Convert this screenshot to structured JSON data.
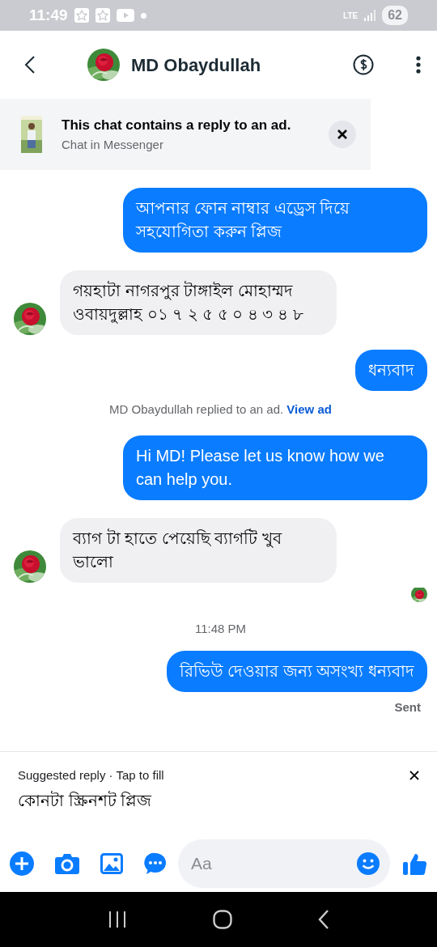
{
  "status_bar": {
    "time": "11:49",
    "network": "LTE",
    "battery": "62"
  },
  "header": {
    "contact_name": "MD Obaydullah"
  },
  "ad_banner": {
    "title": "This chat contains a reply to an ad.",
    "subtitle": "Chat in Messenger"
  },
  "messages": [
    {
      "kind": "outgoing",
      "text": "আপনার ফোন নাম্বার এড্রেস দিয়ে সহযোগিতা করুন প্লিজ"
    },
    {
      "kind": "incoming",
      "text": "গয়হাটা নাগরপুর টাঙ্গাইল মোহাম্মদ ওবায়দুল্লাহ ০১ ৭ ২ ৫ ৫ ০ ৪ ৩ ৪ ৮"
    },
    {
      "kind": "outgoing",
      "text": "ধন্যবাদ"
    },
    {
      "kind": "notice",
      "text": "MD Obaydullah replied to an ad.",
      "link": "View ad"
    },
    {
      "kind": "outgoing",
      "text": "Hi MD! Please let us know how we can help you."
    },
    {
      "kind": "incoming",
      "text": "ব্যাগ টা হাতে পেয়েছি ব্যাগটি খুব ভালো"
    },
    {
      "kind": "seen"
    },
    {
      "kind": "time",
      "text": "11:48 PM"
    },
    {
      "kind": "outgoing",
      "text": "রিভিউ দেওয়ার জন্য অসংখ্য ধন্যবাদ"
    },
    {
      "kind": "status",
      "text": "Sent"
    }
  ],
  "suggested_reply": {
    "label": "Suggested reply · Tap to fill",
    "text": "কোনটা স্ক্রিনশট প্লিজ"
  },
  "composer": {
    "placeholder": "Aa"
  }
}
